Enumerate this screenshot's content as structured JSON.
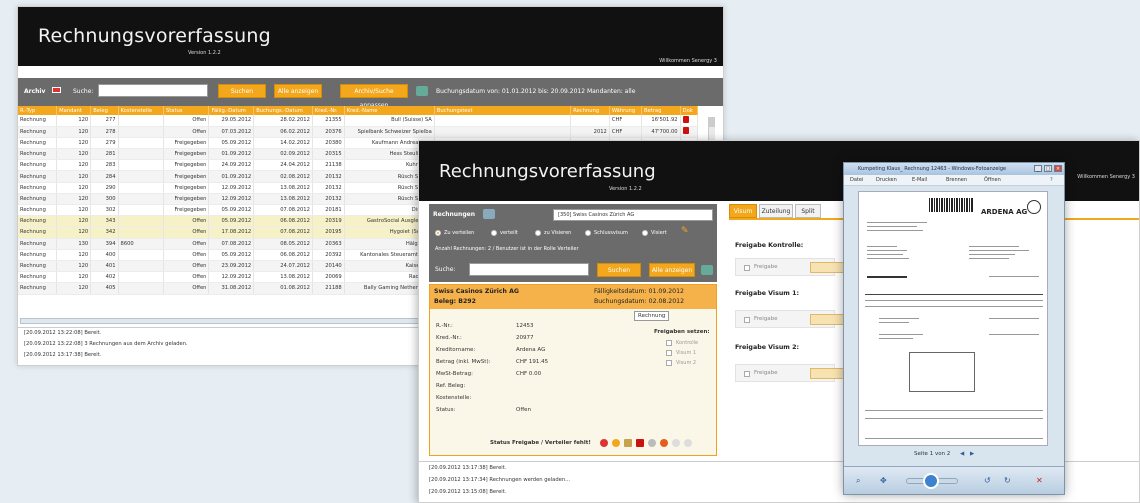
{
  "back": {
    "title": "Rechnungsvorerfassung",
    "version": "Version 1.2.2",
    "welcome": "Willkommen Senergy 3",
    "archive_label": "Archiv",
    "search_label": "Suche:",
    "btn_search": "Suchen",
    "btn_show_all": "Alle anzeigen",
    "btn_adjust": "Archiv/Suche anpassen",
    "date_filter": "Buchungsdatum von: 01.01.2012  bis: 20.09.2012  Mandanten: alle",
    "columns": [
      "R.-Typ",
      "Mandant",
      "Beleg",
      "Kostenstelle",
      "Status",
      "Fällig.-Datum",
      "Buchungs.-Datum",
      "Kred.-Nr.",
      "Kred.-Name",
      "Buchungstext",
      "Rechnung",
      "Währung",
      "Betrag",
      "Dok"
    ],
    "rows": [
      [
        "Rechnung",
        "120",
        "277",
        "",
        "Offen",
        "29.05.2012",
        "28.02.2012",
        "21355",
        "Bull (Suisse) SA",
        "",
        "",
        "CHF",
        "16'501.92"
      ],
      [
        "Rechnung",
        "120",
        "278",
        "",
        "Offen",
        "07.03.2012",
        "06.02.2012",
        "20376",
        "Spielbank Schweizer Spielba",
        "",
        "2012",
        "CHF",
        "47'700.00"
      ],
      [
        "Rechnung",
        "120",
        "279",
        "",
        "Freigegeben",
        "05.09.2012",
        "14.02.2012",
        "20380",
        "Kaufmann Andreas + F",
        "",
        "",
        "",
        ""
      ],
      [
        "Rechnung",
        "120",
        "281",
        "",
        "Freigegeben",
        "01.09.2012",
        "02.09.2012",
        "20315",
        "Hess Steuli & Pa",
        "",
        "",
        "",
        ""
      ],
      [
        "Rechnung",
        "120",
        "283",
        "",
        "Freigegeben",
        "24.09.2012",
        "24.04.2012",
        "21138",
        "Kuhn Graf",
        "",
        "",
        "",
        ""
      ],
      [
        "Rechnung",
        "120",
        "284",
        "",
        "Freigegeben",
        "01.09.2012",
        "02.08.2012",
        "20132",
        "Rüsch Schwe",
        "",
        "",
        "",
        ""
      ],
      [
        "Rechnung",
        "120",
        "290",
        "",
        "Freigegeben",
        "12.09.2012",
        "13.08.2012",
        "20132",
        "Rüsch Schwe",
        "",
        "",
        "",
        ""
      ],
      [
        "Rechnung",
        "120",
        "300",
        "",
        "Freigegeben",
        "12.09.2012",
        "13.08.2012",
        "20132",
        "Rüsch Schwe",
        "",
        "",
        "",
        ""
      ],
      [
        "Rechnung",
        "120",
        "302",
        "",
        "Freigegeben",
        "05.09.2012",
        "07.08.2012",
        "20181",
        "Distrele",
        "",
        "",
        "",
        ""
      ],
      [
        "Rechnung",
        "120",
        "343",
        "",
        "Offen",
        "05.09.2012",
        "06.08.2012",
        "20319",
        "GastroSocial Ausgleichsk",
        "",
        "",
        "",
        ""
      ],
      [
        "Rechnung",
        "120",
        "342",
        "",
        "Offen",
        "17.08.2012",
        "07.08.2012",
        "20195",
        "Hygoiet (Schwei",
        "",
        "",
        "",
        ""
      ],
      [
        "Rechnung",
        "130",
        "394",
        "8600",
        "Offen",
        "07.08.2012",
        "08.05.2012",
        "20363",
        "Hälg & Co",
        "",
        "",
        "",
        ""
      ],
      [
        "Rechnung",
        "120",
        "400",
        "",
        "Offen",
        "05.09.2012",
        "06.08.2012",
        "20392",
        "Kantonales Steueramt, Que",
        "",
        "",
        "",
        ""
      ],
      [
        "Rechnung",
        "120",
        "401",
        "",
        "Offen",
        "23.09.2012",
        "24.07.2012",
        "20140",
        "Kaiser  Kre",
        "",
        "",
        "",
        ""
      ],
      [
        "Rechnung",
        "120",
        "402",
        "",
        "Offen",
        "12.09.2012",
        "13.08.2012",
        "20069",
        "Radio Tir",
        "",
        "",
        "",
        ""
      ],
      [
        "Rechnung",
        "120",
        "405",
        "",
        "Offen",
        "31.08.2012",
        "01.08.2012",
        "21188",
        "Bally Gaming Netherlands",
        "",
        "",
        "",
        ""
      ]
    ],
    "log": [
      "[20.09.2012 13:22:08] Bereit.",
      "[20.09.2012 13:22:08] 3 Rechnungen aus dem Archiv geladen.",
      "[20.09.2012 13:17:38] Bereit."
    ]
  },
  "front": {
    "title": "Rechnungsvorerfassung",
    "version": "Version 1.2.2",
    "welcome": "Willkommen Senergy 3",
    "invoices_label": "Rechnungen",
    "client_select": "[350] Swiss Casinos Zürich AG",
    "filters": [
      "Zu verteilen",
      "verteilt",
      "zu Visieren",
      "Schlussvisum",
      "Visiert"
    ],
    "count_text": "Anzahl Rechnungen: 2 / Benutzer ist in der Rolle Verteiler",
    "search_label": "Suche:",
    "btn_search": "Suchen",
    "btn_show_all": "Alle anzeigen",
    "card": {
      "company": "Swiss Casinos Zürich AG",
      "beleg": "Beleg: B292",
      "due": "Fälligkeitsdatum: 01.09.2012",
      "booking": "Buchungsdatum: 02.08.2012",
      "tooltip": "Rechnung",
      "fields": [
        {
          "k": "R.-Nr.:",
          "v": "12453"
        },
        {
          "k": "Kred.-Nr.:",
          "v": "20977"
        },
        {
          "k": "Kreditorname:",
          "v": "Ardena AG"
        },
        {
          "k": "Betrag (inkl. MwSt):",
          "v": "CHF 191.45"
        },
        {
          "k": "MwSt-Betrag:",
          "v": "CHF 0.00"
        },
        {
          "k": "Ref. Beleg:",
          "v": ""
        },
        {
          "k": "Kostenstelle:",
          "v": ""
        },
        {
          "k": "Status:",
          "v": "Offen"
        }
      ],
      "release_title": "Freigaben setzen:",
      "releases": [
        "Kontrolle",
        "Visum 1",
        "Visum 2"
      ],
      "status_text": "Status Freigabe / Verteiler fehlt!"
    },
    "tabs": [
      "Visum",
      "Zuteilung",
      "Split"
    ],
    "sections": [
      "Freigabe Kontrolle:",
      "Freigabe Visum 1:",
      "Freigabe Visum 2:"
    ],
    "release_label": "Freigabe",
    "log": [
      "[20.09.2012 13:17:38] Bereit.",
      "[20.09.2012 13:17:34] Rechnungen werden geladen...",
      "[20.09.2012 13:15:08] Bereit."
    ]
  },
  "viewer": {
    "title": "Kumpeting Klaus_ Rechnung 12463 - Windows-Fotoanzeige",
    "menu": [
      "Datei",
      "Drucken",
      "E-Mail",
      "Brennen",
      "Öffnen"
    ],
    "page_label": "Seite 1 von 2",
    "doc_company": "ARDENA AG"
  }
}
